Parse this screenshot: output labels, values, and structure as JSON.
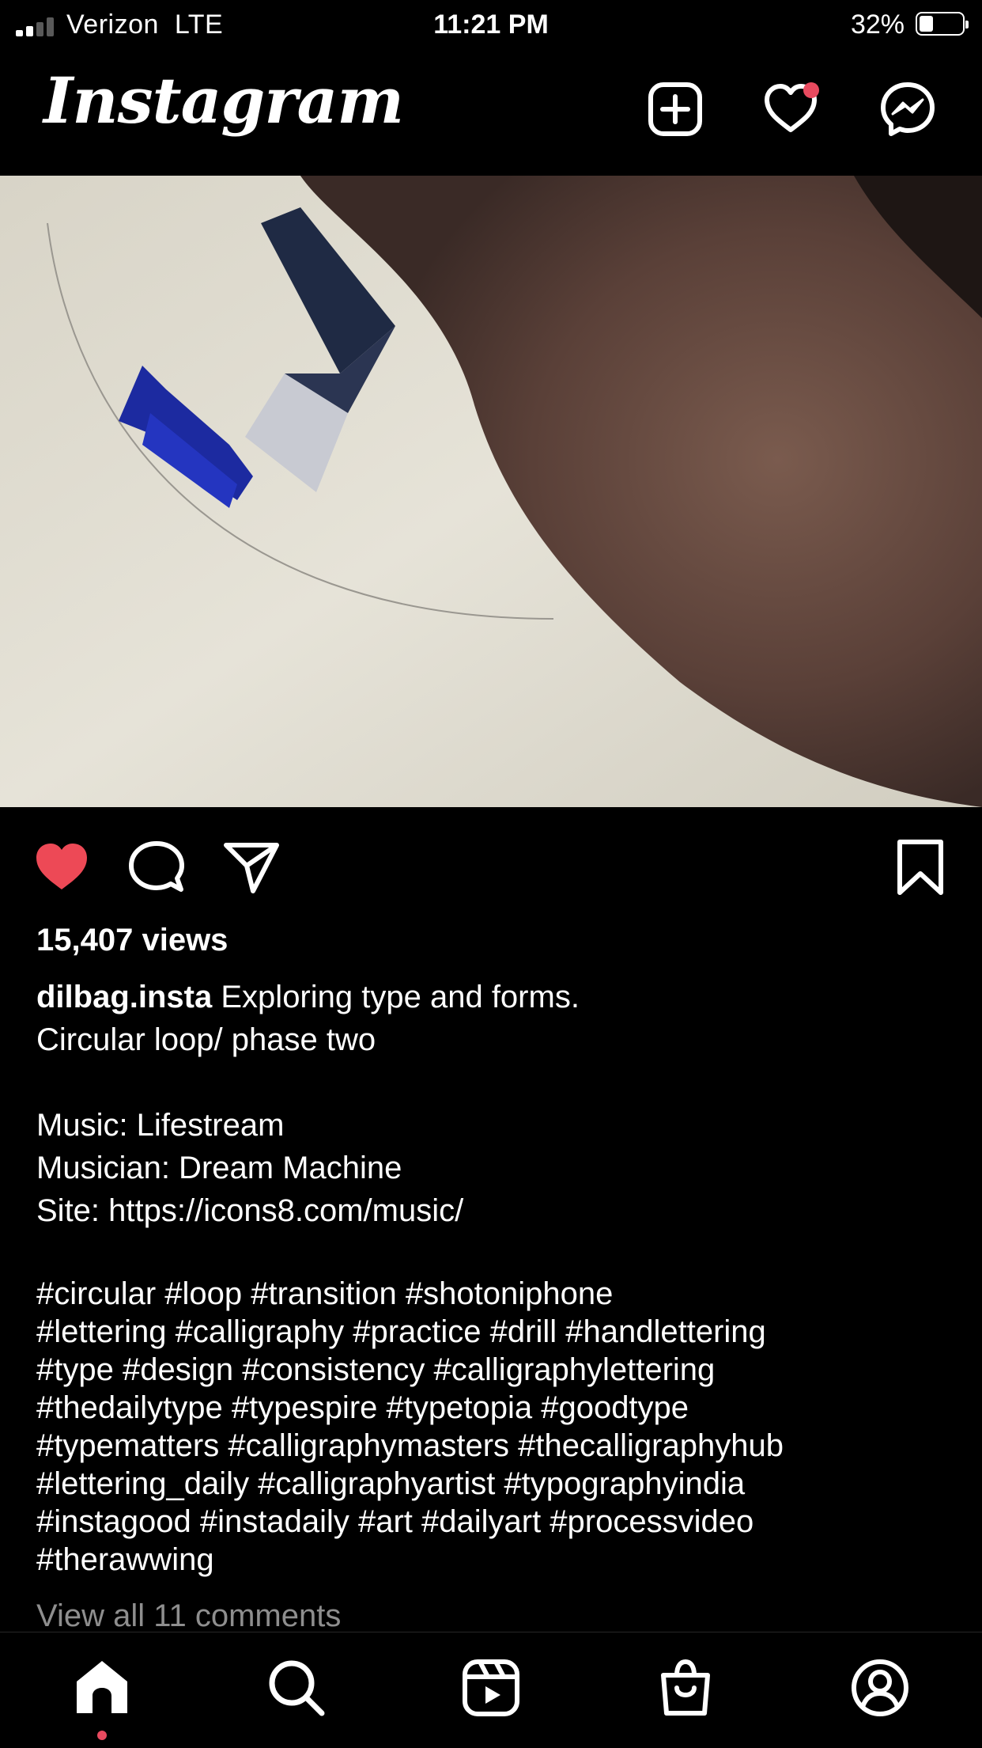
{
  "status_bar": {
    "carrier": "Verizon",
    "network": "LTE",
    "time": "11:21 PM",
    "battery_percent": "32%",
    "battery_level": 0.32,
    "signal_bars": 2
  },
  "header": {
    "logo": "Instagram",
    "icons": [
      "new-post-icon",
      "activity-heart-icon",
      "messenger-icon"
    ],
    "notification_dot_color": "#e84a5f"
  },
  "post": {
    "media_description_icon": "calligraphy-video",
    "liked": true,
    "like_color": "#ed4956",
    "views": "15,407 views",
    "username": "dilbag.insta",
    "caption_first": "Exploring type and forms.",
    "caption_lines": [
      "Circular loop/ phase two",
      "",
      "Music: Lifestream",
      "Musician: Dream Machine",
      "Site: https://icons8.com/music/",
      ""
    ],
    "hashtag_lines": [
      "#circular #loop #transition #shotoniphone",
      "#lettering #calligraphy #practice #drill #handlettering",
      "#type #design #consistency #calligraphylettering",
      "#thedailytype #typespire #typetopia #goodtype",
      "#typematters #calligraphymasters #thecalligraphyhub",
      "#lettering_daily #calligraphyartist  #typographyindia",
      "#instagood #instadaily #art #dailyart #processvideo",
      "#therawwing"
    ],
    "view_comments": "View all 11 comments"
  },
  "bottom_nav": {
    "items": [
      "home-icon",
      "search-icon",
      "reels-icon",
      "shop-icon",
      "profile-icon"
    ],
    "active": "home-icon"
  }
}
